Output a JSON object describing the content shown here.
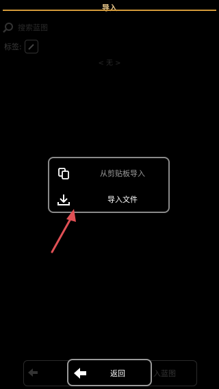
{
  "header": {
    "title": "导入"
  },
  "background": {
    "search_placeholder": "搜索蓝图",
    "tag_label": "标签:",
    "none_text": "< 无 >",
    "bottom_right_text": "入蓝图"
  },
  "popup": {
    "items": [
      {
        "label": "从剪贴板导入",
        "icon": "copy-icon"
      },
      {
        "label": "导入文件",
        "icon": "download-icon"
      }
    ]
  },
  "back_button": {
    "label": "返回",
    "icon": "arrow-left-icon"
  },
  "colors": {
    "accent": "#d39a3a",
    "title": "#e6c58a",
    "annotation": "#e05055",
    "popup_border": "#8a8a8a"
  }
}
